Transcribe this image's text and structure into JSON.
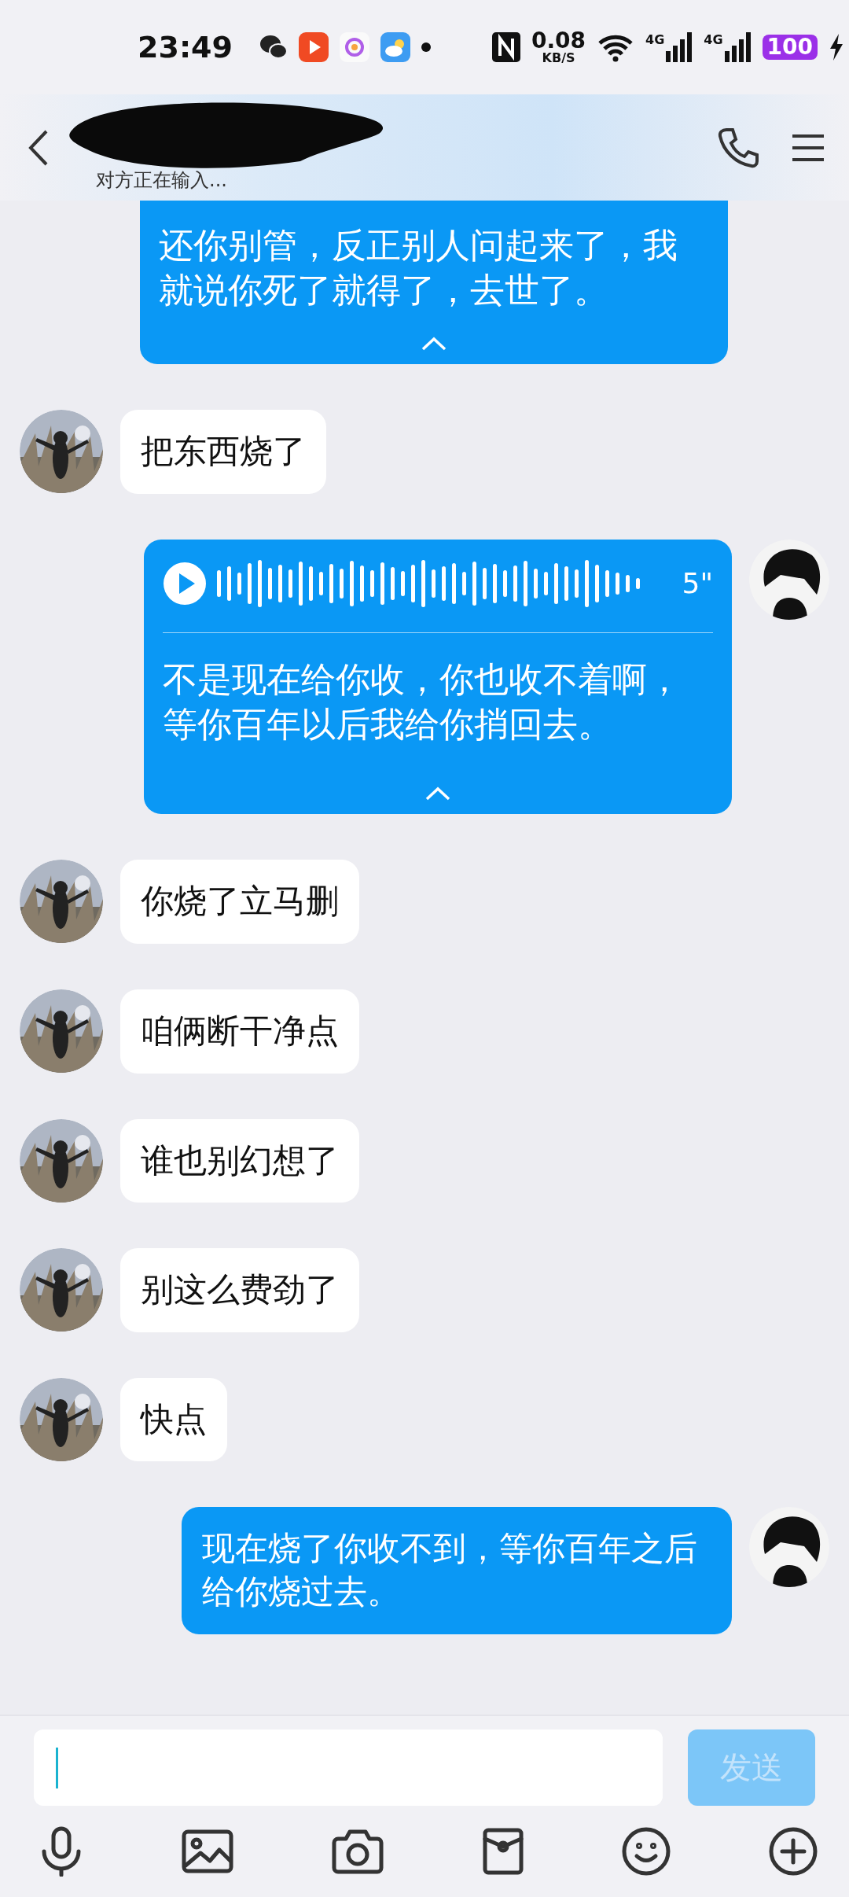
{
  "status_bar": {
    "time": "23:49",
    "net_speed": "0.08",
    "net_speed_unit": "KB/S",
    "signals": [
      {
        "label": "4G"
      },
      {
        "label": "4G"
      }
    ],
    "battery": "100",
    "charging": true
  },
  "header": {
    "subtitle": "对方正在输入...",
    "name_redacted": true
  },
  "messages": [
    {
      "kind": "transcript",
      "sent": true,
      "text": "还你别管，反正别人问起来了，我就说你死了就得了，去世了。",
      "expanded": true
    },
    {
      "kind": "text",
      "sent": false,
      "text": "把东西烧了"
    },
    {
      "kind": "voice",
      "sent": true,
      "duration": "5\"",
      "text": "不是现在给你收，你也收不着啊，等你百年以后我给你捎回去。",
      "expanded": true
    },
    {
      "kind": "text",
      "sent": false,
      "text": "你烧了立马删"
    },
    {
      "kind": "text",
      "sent": false,
      "text": "咱俩断干净点"
    },
    {
      "kind": "text",
      "sent": false,
      "text": "谁也别幻想了"
    },
    {
      "kind": "text",
      "sent": false,
      "text": "别这么费劲了"
    },
    {
      "kind": "text",
      "sent": false,
      "text": "快点"
    },
    {
      "kind": "text",
      "sent": true,
      "text": "现在烧了你收不到，等你百年之后给你烧过去。"
    }
  ],
  "composer": {
    "send_label": "发送",
    "send_disabled": true
  }
}
